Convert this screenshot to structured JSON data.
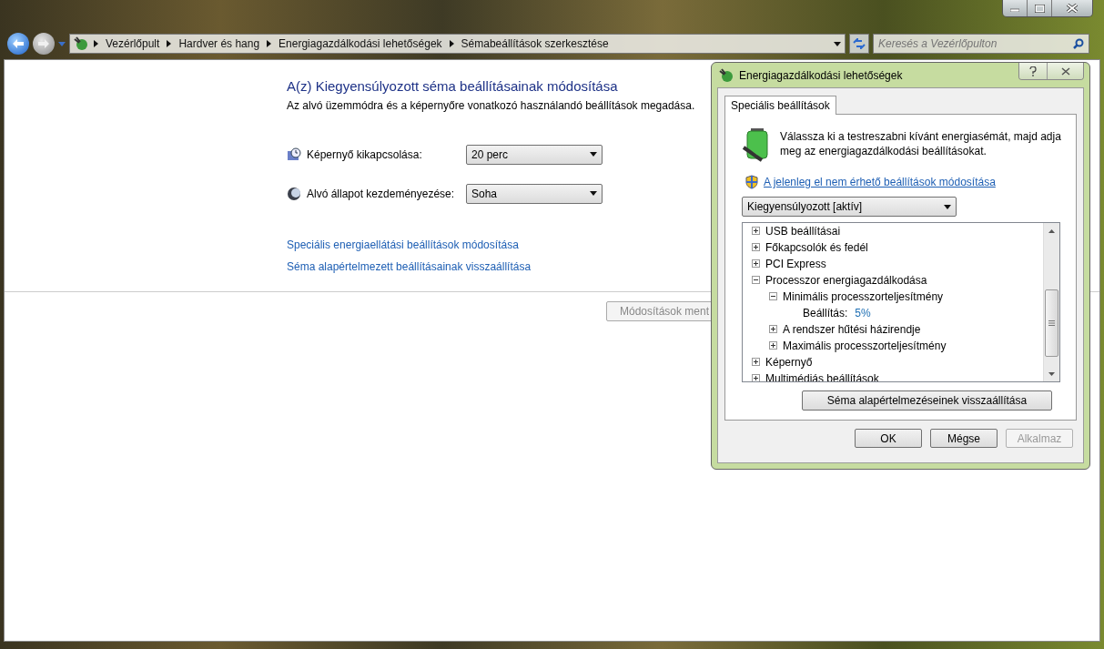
{
  "address_bar": {
    "breadcrumb": [
      "Vezérlőpult",
      "Hardver és hang",
      "Energiagazdálkodási lehetőségek",
      "Sémabeállítások szerkesztése"
    ],
    "search": {
      "placeholder": "Keresés a Vezérlőpulton"
    }
  },
  "page": {
    "title": "A(z) Kiegyensúlyozott séma beállításainak módosítása",
    "subtitle": "Az alvó üzemmódra és a képernyőre vonatkozó használandó beállítások megadása.",
    "settings": [
      {
        "kind": "display",
        "label": "Képernyő kikapcsolása:",
        "value": "20 perc"
      },
      {
        "kind": "sleep",
        "label": "Alvó állapot kezdeményezése:",
        "value": "Soha"
      }
    ],
    "links": [
      "Speciális energiaellátási beállítások módosítása",
      "Séma alapértelmezett beállításainak visszaállítása"
    ],
    "save_button": {
      "label": "Módosítások ment",
      "disabled": true
    }
  },
  "dialog": {
    "title": "Energiagazdálkodási lehetőségek",
    "tabs": [
      {
        "label": "Speciális beállítások",
        "selected": true
      }
    ],
    "intro": "Válassza ki a testreszabni kívánt energiasémát, majd adja meg az energiagazdálkodási beállításokat.",
    "admin_link": "A jelenleg el nem érhető beállítások módosítása",
    "plan": "Kiegyensúlyozott [aktív]",
    "tree": [
      {
        "kind": "group",
        "label": "USB beállításai",
        "expanded": false
      },
      {
        "kind": "group",
        "label": "Főkapcsolók és fedél",
        "expanded": false
      },
      {
        "kind": "group",
        "label": "PCI Express",
        "expanded": false
      },
      {
        "kind": "group",
        "label": "Processzor energiagazdálkodása",
        "expanded": true,
        "children": [
          {
            "kind": "group",
            "label": "Minimális processzorteljesítmény",
            "expanded": true,
            "children": [
              {
                "kind": "setting",
                "label": "Beállítás:",
                "value": "5%"
              }
            ]
          },
          {
            "kind": "group",
            "label": "A rendszer hűtési házirendje",
            "expanded": false
          },
          {
            "kind": "group",
            "label": "Maximális processzorteljesítmény",
            "expanded": false
          }
        ]
      },
      {
        "kind": "group",
        "label": "Képernyő",
        "expanded": false
      },
      {
        "kind": "group",
        "label": "Multimédiás beállítások",
        "expanded": false
      }
    ],
    "restore_button": "Séma alapértelmezéseinek visszaállítása",
    "buttons": [
      {
        "label": "OK",
        "disabled": false
      },
      {
        "label": "Mégse",
        "disabled": false
      },
      {
        "label": "Alkalmaz",
        "disabled": true
      }
    ]
  }
}
